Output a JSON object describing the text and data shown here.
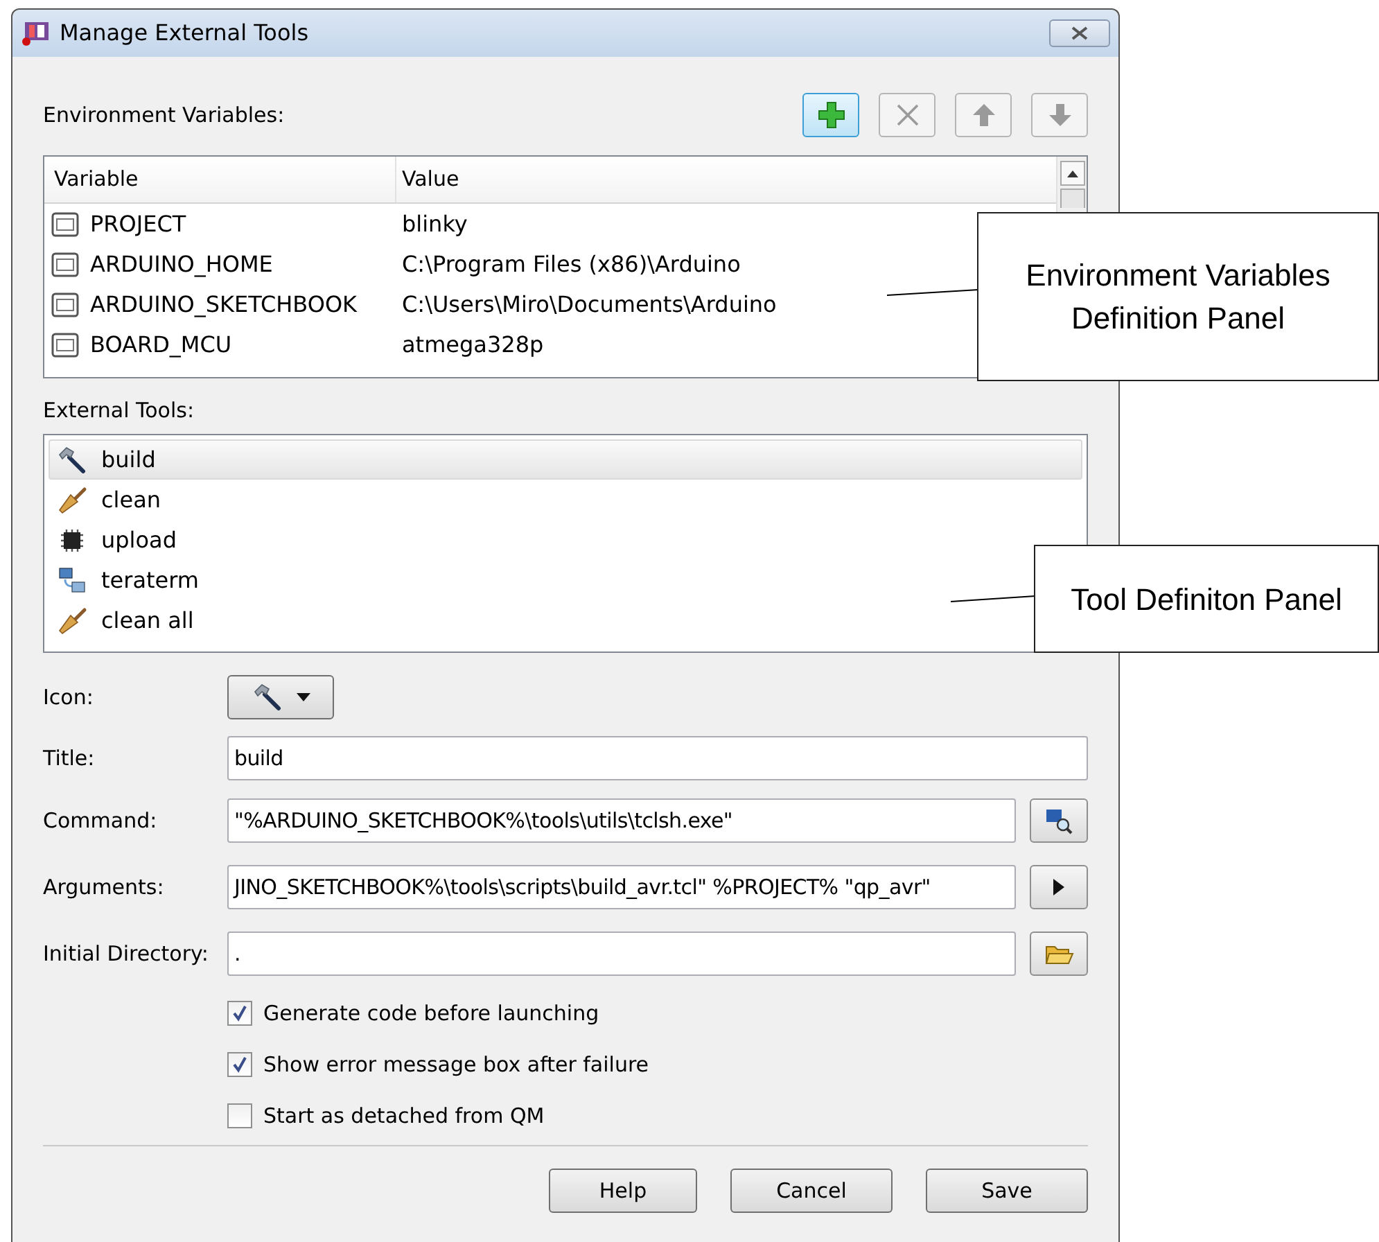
{
  "window": {
    "title": "Manage External Tools"
  },
  "environment_variables": {
    "label": "Environment Variables:",
    "toolbar": [
      {
        "kind": "add",
        "disabled": false
      },
      {
        "kind": "remove",
        "disabled": true
      },
      {
        "kind": "up",
        "disabled": true
      },
      {
        "kind": "down",
        "disabled": true
      }
    ],
    "columns": [
      "Variable",
      "Value"
    ],
    "rows": [
      {
        "variable": "PROJECT",
        "value": "blinky"
      },
      {
        "variable": "ARDUINO_HOME",
        "value": "C:\\Program Files (x86)\\Arduino"
      },
      {
        "variable": "ARDUINO_SKETCHBOOK",
        "value": "C:\\Users\\Miro\\Documents\\Arduino"
      },
      {
        "variable": "BOARD_MCU",
        "value": "atmega328p"
      }
    ]
  },
  "external_tools": {
    "label": "External Tools:",
    "items": [
      {
        "title": "build",
        "kind": "hammer",
        "selected": true
      },
      {
        "title": "clean",
        "kind": "broom",
        "selected": false
      },
      {
        "title": "upload",
        "kind": "chip",
        "selected": false
      },
      {
        "title": "teraterm",
        "kind": "terminal",
        "selected": false
      },
      {
        "title": "clean all",
        "kind": "broom",
        "selected": false
      }
    ]
  },
  "form": {
    "icon_label": "Icon:",
    "icon": {
      "kind": "hammer"
    },
    "fields": [
      {
        "label": "Title:",
        "value": "build",
        "kind": "plain"
      },
      {
        "label": "Command:",
        "value": "\"%ARDUINO_SKETCHBOOK%\\tools\\utils\\tclsh.exe\"",
        "kind": "browse"
      },
      {
        "label": "Arguments:",
        "value": "JINO_SKETCHBOOK%\\tools\\scripts\\build_avr.tcl\" %PROJECT% \"qp_avr\"",
        "kind": "menu"
      },
      {
        "label": "Initial Directory:",
        "value": ".",
        "kind": "folder"
      }
    ],
    "checkboxes": [
      {
        "label": "Generate code before launching",
        "checked": true
      },
      {
        "label": "Show error message box after failure",
        "checked": true
      },
      {
        "label": "Start as detached from QM",
        "checked": false
      }
    ]
  },
  "buttons": [
    "Help",
    "Cancel",
    "Save"
  ],
  "callouts": [
    {
      "text": "Environment Variables Definition Panel"
    },
    {
      "text": "Tool Definiton Panel"
    }
  ]
}
